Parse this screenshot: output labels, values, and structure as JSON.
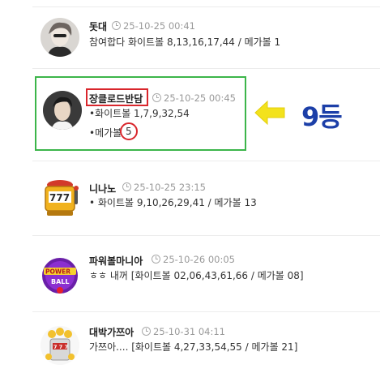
{
  "comments": [
    {
      "name": "돗대",
      "time": "25-10-25 00:41",
      "lines": [
        "참여합다 화이트볼 8,13,16,17,44 / 메가볼 1"
      ]
    },
    {
      "name": "장클로드반담",
      "time": "25-10-25 00:45",
      "lines": [
        "•화이트볼 1,7,9,32,54",
        "•메가볼",
        "5"
      ]
    },
    {
      "name": "니나노",
      "time": "25-10-25 23:15",
      "lines": [
        "• 화이트볼 9,10,26,29,41 / 메가볼 13"
      ]
    },
    {
      "name": "파워볼마니아",
      "time": "25-10-26 00:05",
      "lines": [
        "ㅎㅎ 내꺼 [화이트볼 02,06,43,61,66 / 메가볼 08]"
      ]
    },
    {
      "name": "대박가쯔아",
      "time": "25-10-31 04:11",
      "lines": [
        "가쯔아.... [화이트볼 4,27,33,54,55 / 메가볼 21]"
      ]
    }
  ],
  "annotation": {
    "rank_label": "9등",
    "highlight_color": "#3cb54a",
    "mark_color": "#d9262c",
    "arrow_color": "#f3e21c"
  },
  "icons": [
    "clock-icon",
    "avatar-photo",
    "slot-777-icon",
    "powerball-logo",
    "jackpot-machine-icon"
  ]
}
